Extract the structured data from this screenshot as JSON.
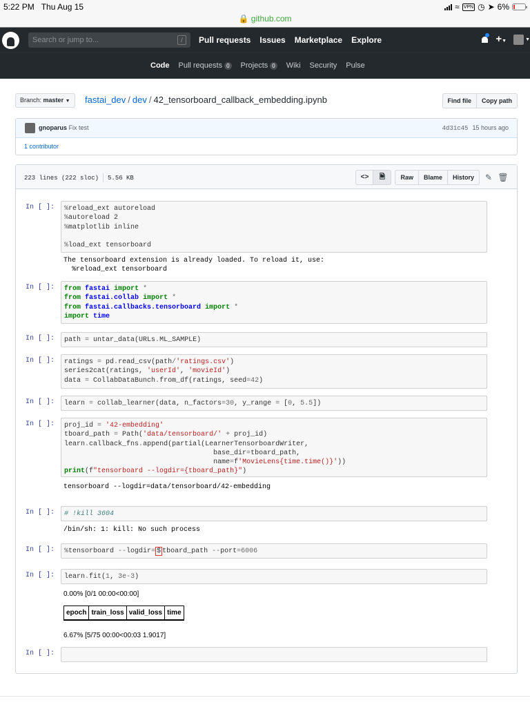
{
  "status_bar": {
    "time": "5:22 PM",
    "date": "Thu Aug 15",
    "url": "github.com",
    "vpn_label": "VPN",
    "battery": "6%"
  },
  "header": {
    "search_placeholder": "Search or jump to...",
    "search_shortcut": "/",
    "nav": [
      "Pull requests",
      "Issues",
      "Marketplace",
      "Explore"
    ]
  },
  "repo_nav": {
    "code": "Code",
    "pull_requests": "Pull requests",
    "pull_requests_count": "0",
    "projects": "Projects",
    "projects_count": "0",
    "wiki": "Wiki",
    "security": "Security",
    "pulse": "Pulse"
  },
  "file_nav": {
    "branch_label": "Branch:",
    "branch": "master",
    "repo": "fastai_dev",
    "dir": "dev",
    "file": "42_tensorboard_callback_embedding.ipynb",
    "find_file": "Find file",
    "copy_path": "Copy path"
  },
  "commit": {
    "author": "gnoparus",
    "message": "Fix test",
    "sha": "4d31c45",
    "time": "15 hours ago",
    "contributors": "1 contributor"
  },
  "file_header": {
    "lines": "223 lines (222 sloc)",
    "size": "5.56 KB",
    "raw": "Raw",
    "blame": "Blame",
    "history": "History"
  },
  "notebook": {
    "prompt": "In [ ]:",
    "outputs": {
      "c1": "The tensorboard extension is already loaded. To reload it, use:\n  %reload_ext tensorboard",
      "c6": "tensorboard --logdir=data/tensorboard/42-embedding",
      "c7": "/bin/sh: 1: kill: No such process",
      "c9_progress1": "0.00% [0/1 00:00<00:00]",
      "c9_progress2": "6.67% [5/75 00:00<00:03 1.9017]"
    },
    "loss_table_headers": [
      "epoch",
      "train_loss",
      "valid_loss",
      "time"
    ]
  }
}
